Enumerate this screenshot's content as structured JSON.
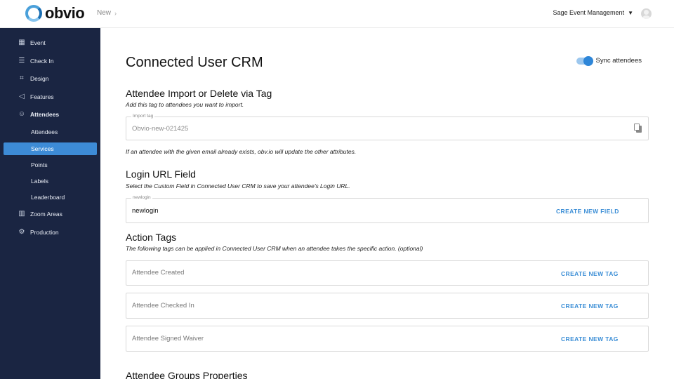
{
  "header": {
    "logo_text": "obvio",
    "breadcrumb": "New",
    "organization": "Sage Event Management"
  },
  "sidebar": {
    "items": [
      {
        "label": "Event",
        "icon": "calendar-icon"
      },
      {
        "label": "Check In",
        "icon": "checklist-icon"
      },
      {
        "label": "Design",
        "icon": "crop-icon"
      },
      {
        "label": "Features",
        "icon": "megaphone-icon"
      },
      {
        "label": "Attendees",
        "icon": "people-icon"
      },
      {
        "label": "Zoom Areas",
        "icon": "zoom-areas-icon"
      },
      {
        "label": "Production",
        "icon": "gears-icon"
      }
    ],
    "sub_items": [
      {
        "label": "Attendees"
      },
      {
        "label": "Services",
        "active": true
      },
      {
        "label": "Points"
      },
      {
        "label": "Labels"
      },
      {
        "label": "Leaderboard"
      }
    ]
  },
  "main": {
    "title": "Connected User CRM",
    "sync_label": "Sync attendees",
    "sync_on": true,
    "import_section": {
      "heading": "Attendee Import or Delete via Tag",
      "subtitle": "Add this tag to attendees you want to import.",
      "field_label": "Import tag",
      "field_value": "Obvio-new-021425",
      "note": "If an attendee with the given email already exists, obv.io will update the other attributes."
    },
    "login_section": {
      "heading": "Login URL Field",
      "subtitle": "Select the Custom Field in Connected User CRM to save your attendee's Login URL.",
      "field_label": "newlogin",
      "field_value": "newlogin",
      "button": "CREATE NEW FIELD"
    },
    "action_tags": {
      "heading": "Action Tags",
      "subtitle": "The following tags can be applied in Connected User CRM when an attendee takes the specific action. (optional)",
      "rows": [
        {
          "label": "Attendee Created",
          "button": "CREATE NEW TAG"
        },
        {
          "label": "Attendee Checked In",
          "button": "CREATE NEW TAG"
        },
        {
          "label": "Attendee Signed Waiver",
          "button": "CREATE NEW TAG"
        }
      ]
    },
    "groups_heading": "Attendee Groups Properties"
  },
  "colors": {
    "sidebar_bg": "#1a2542",
    "active_item": "#3d8bd6",
    "accent": "#3b8ed6"
  }
}
